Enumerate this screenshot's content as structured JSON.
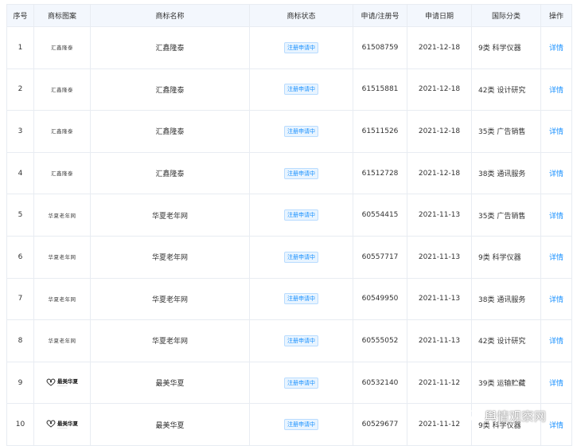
{
  "columns": [
    "序号",
    "商标图案",
    "商标名称",
    "商标状态",
    "申请/注册号",
    "申请日期",
    "国际分类",
    "操作"
  ],
  "rows": [
    {
      "index": "1",
      "logo": "汇鑫隆泰",
      "logo_style": "text-serif",
      "name": "汇鑫隆泰",
      "status": "注册申请中",
      "reg_no": "61508759",
      "date": "2021-12-18",
      "category": "9类 科学仪器",
      "action": "详情"
    },
    {
      "index": "2",
      "logo": "汇鑫隆泰",
      "logo_style": "text-serif",
      "name": "汇鑫隆泰",
      "status": "注册申请中",
      "reg_no": "61515881",
      "date": "2021-12-18",
      "category": "42类 设计研究",
      "action": "详情"
    },
    {
      "index": "3",
      "logo": "汇鑫隆泰",
      "logo_style": "text-serif",
      "name": "汇鑫隆泰",
      "status": "注册申请中",
      "reg_no": "61511526",
      "date": "2021-12-18",
      "category": "35类 广告销售",
      "action": "详情"
    },
    {
      "index": "4",
      "logo": "汇鑫隆泰",
      "logo_style": "text-serif",
      "name": "汇鑫隆泰",
      "status": "注册申请中",
      "reg_no": "61512728",
      "date": "2021-12-18",
      "category": "38类 通讯服务",
      "action": "详情"
    },
    {
      "index": "5",
      "logo": "华夏老年网",
      "logo_style": "text",
      "name": "华夏老年网",
      "status": "注册申请中",
      "reg_no": "60554415",
      "date": "2021-11-13",
      "category": "35类 广告销售",
      "action": "详情"
    },
    {
      "index": "6",
      "logo": "华夏老年网",
      "logo_style": "text",
      "name": "华夏老年网",
      "status": "注册申请中",
      "reg_no": "60557717",
      "date": "2021-11-13",
      "category": "9类 科学仪器",
      "action": "详情"
    },
    {
      "index": "7",
      "logo": "华夏老年网",
      "logo_style": "text",
      "name": "华夏老年网",
      "status": "注册申请中",
      "reg_no": "60549950",
      "date": "2021-11-13",
      "category": "38类 通讯服务",
      "action": "详情"
    },
    {
      "index": "8",
      "logo": "华夏老年网",
      "logo_style": "text",
      "name": "华夏老年网",
      "status": "注册申请中",
      "reg_no": "60555052",
      "date": "2021-11-13",
      "category": "42类 设计研究",
      "action": "详情"
    },
    {
      "index": "9",
      "logo": "最美华夏",
      "logo_style": "graphic",
      "name": "最美华夏",
      "status": "注册申请中",
      "reg_no": "60532140",
      "date": "2021-11-12",
      "category": "39类 运输贮藏",
      "action": "详情"
    },
    {
      "index": "10",
      "logo": "最美华夏",
      "logo_style": "graphic",
      "name": "最美华夏",
      "status": "注册申请中",
      "reg_no": "60529677",
      "date": "2021-11-12",
      "category": "9类 科学仪器",
      "action": "详情"
    }
  ],
  "watermark": {
    "text": "舆情观察网",
    "icon": "wechat-icon"
  },
  "colors": {
    "header_bg": "#f3f7fd",
    "link": "#1890ff",
    "badge_bg": "#e8f4ff",
    "border": "#e8ecf2"
  }
}
